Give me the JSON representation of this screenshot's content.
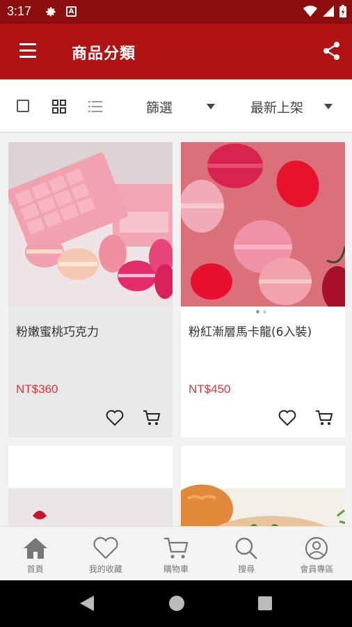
{
  "status_bar": {
    "time": "3:17"
  },
  "app_bar": {
    "title": "商品分類"
  },
  "toolbar": {
    "filter_label": "篩選",
    "sort_label": "最新上架"
  },
  "products": [
    {
      "name": "粉嫩蜜桃巧克力",
      "price": "NT$360"
    },
    {
      "name": "粉紅漸層馬卡龍(6入裝)",
      "price": "NT$450"
    },
    {
      "name": "",
      "price": ""
    },
    {
      "name": "",
      "price": ""
    }
  ],
  "bottom_nav": [
    {
      "label": "首頁",
      "icon": "home-icon"
    },
    {
      "label": "我的收藏",
      "icon": "heart-icon"
    },
    {
      "label": "購物車",
      "icon": "cart-icon"
    },
    {
      "label": "搜尋",
      "icon": "search-icon"
    },
    {
      "label": "會員專區",
      "icon": "user-icon"
    }
  ],
  "colors": {
    "status_bar": "#8c0d0d",
    "app_bar": "#b11313",
    "price": "#e03434"
  }
}
